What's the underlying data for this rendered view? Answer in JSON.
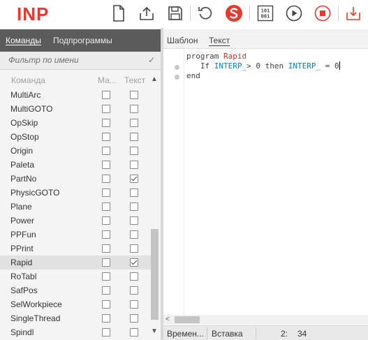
{
  "app": {
    "logo_text": "INP"
  },
  "toolbar": {
    "buttons": [
      {
        "name": "new-file",
        "icon": "file-icon"
      },
      {
        "name": "upload",
        "icon": "upload-icon"
      },
      {
        "name": "save",
        "icon": "save-icon"
      },
      {
        "name": "reload",
        "icon": "reload-icon"
      },
      {
        "name": "snippet",
        "icon": "s-logo-icon"
      },
      {
        "name": "binary",
        "icon": "binary-icon"
      },
      {
        "name": "run",
        "icon": "play-icon"
      },
      {
        "name": "stop",
        "icon": "stop-icon"
      },
      {
        "name": "export",
        "icon": "export-icon"
      }
    ],
    "binary_glyph_top": "101",
    "binary_glyph_bottom": "001",
    "accent_color": "#e8392f"
  },
  "left_panel": {
    "tabs": [
      {
        "label": "Команды",
        "active": true
      },
      {
        "label": "Подпрограммы",
        "active": false
      }
    ],
    "filter": {
      "placeholder": "Фильтр по имени",
      "value": ""
    },
    "columns": {
      "command": "Команда",
      "ma": "Ма...",
      "text": "Текст"
    },
    "rows": [
      {
        "name": "MultiArc",
        "ma": false,
        "text": false,
        "selected": false
      },
      {
        "name": "MultiGOTO",
        "ma": false,
        "text": false,
        "selected": false
      },
      {
        "name": "OpSkip",
        "ma": false,
        "text": false,
        "selected": false
      },
      {
        "name": "OpStop",
        "ma": false,
        "text": false,
        "selected": false
      },
      {
        "name": "Origin",
        "ma": false,
        "text": false,
        "selected": false
      },
      {
        "name": "Paleta",
        "ma": false,
        "text": false,
        "selected": false
      },
      {
        "name": "PartNo",
        "ma": false,
        "text": true,
        "selected": false
      },
      {
        "name": "PhysicGOTO",
        "ma": false,
        "text": false,
        "selected": false
      },
      {
        "name": "Plane",
        "ma": false,
        "text": false,
        "selected": false
      },
      {
        "name": "Power",
        "ma": false,
        "text": false,
        "selected": false
      },
      {
        "name": "PPFun",
        "ma": false,
        "text": false,
        "selected": false
      },
      {
        "name": "PPrint",
        "ma": false,
        "text": false,
        "selected": false
      },
      {
        "name": "Rapid",
        "ma": false,
        "text": true,
        "selected": true
      },
      {
        "name": "RoTabl",
        "ma": false,
        "text": false,
        "selected": false
      },
      {
        "name": "SafPos",
        "ma": false,
        "text": false,
        "selected": false
      },
      {
        "name": "SelWorkpiece",
        "ma": false,
        "text": false,
        "selected": false
      },
      {
        "name": "SingleThread",
        "ma": false,
        "text": false,
        "selected": false
      },
      {
        "name": "Spindl",
        "ma": false,
        "text": false,
        "selected": false
      }
    ]
  },
  "right_panel": {
    "tabs": [
      {
        "label": "Шаблон",
        "active": false
      },
      {
        "label": "Текст",
        "active": true
      }
    ],
    "code": {
      "line1_kw": "program",
      "line1_name": "Rapid",
      "line2_if": "If",
      "line2_var1": "INTERP_",
      "line2_op": "> 0 then",
      "line2_var2": "INTERP_",
      "line2_assign": "= 0",
      "line3": "end"
    },
    "status": {
      "time": "Времен...",
      "mode": "Вставка",
      "line": "2:",
      "col": "34"
    }
  }
}
